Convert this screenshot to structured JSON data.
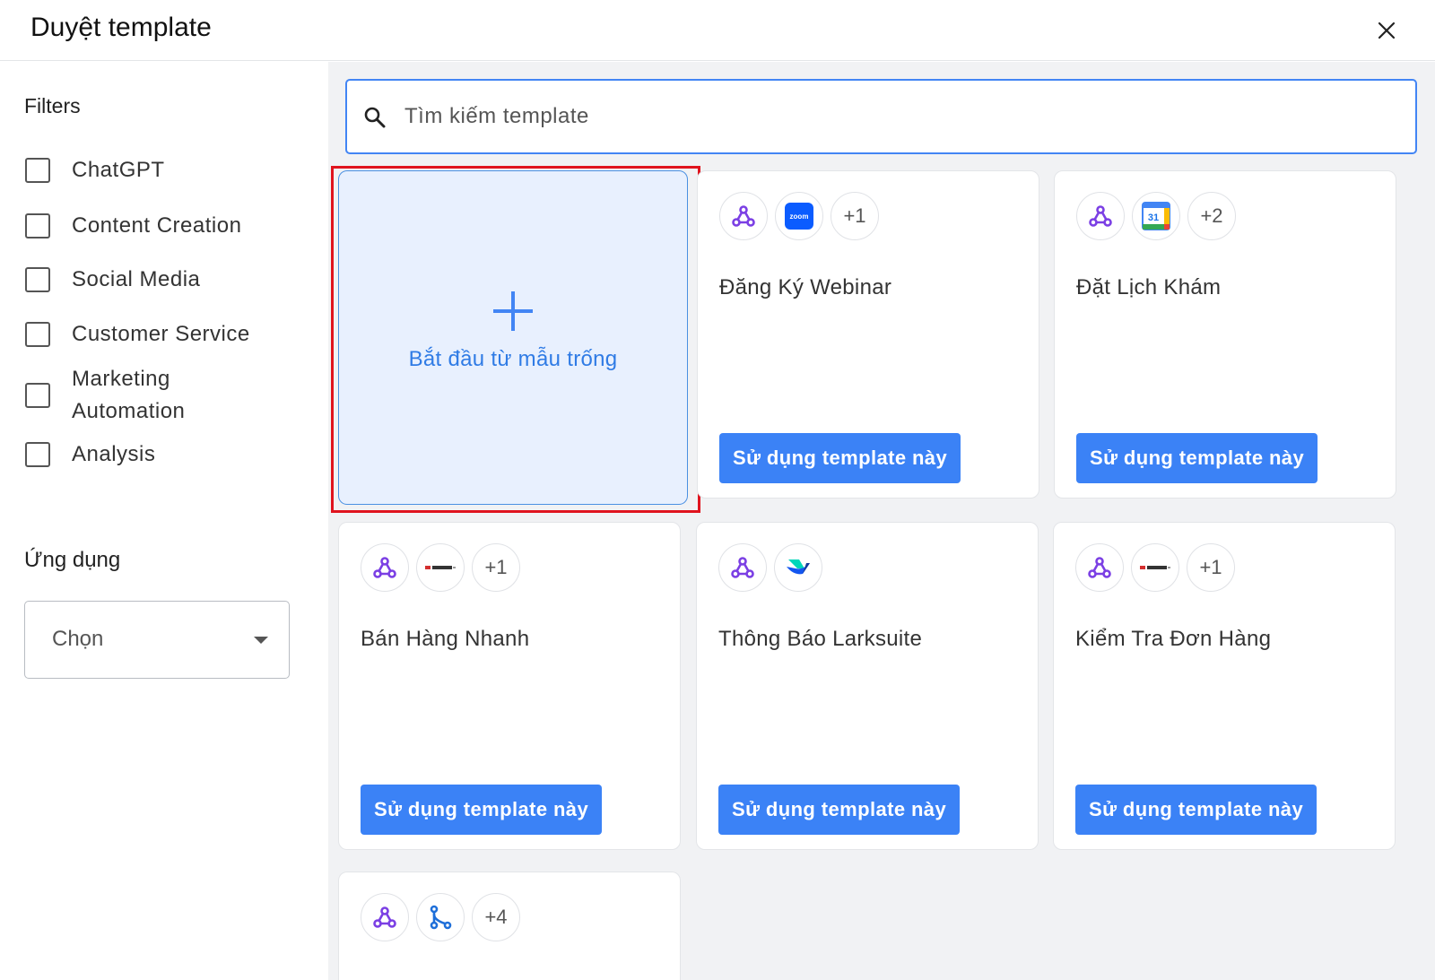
{
  "header": {
    "title": "Duyệt template"
  },
  "sidebar": {
    "filters_title": "Filters",
    "filters": [
      {
        "label": "ChatGPT",
        "checked": false
      },
      {
        "label": "Content Creation",
        "checked": false
      },
      {
        "label": "Social Media",
        "checked": false
      },
      {
        "label": "Customer Service",
        "checked": false
      },
      {
        "label": "Marketing Automation",
        "checked": false
      },
      {
        "label": "Analysis",
        "checked": false
      }
    ],
    "apps_title": "Ứng dụng",
    "apps_select": {
      "value": "Chọn"
    }
  },
  "search": {
    "placeholder": "Tìm kiếm template",
    "value": ""
  },
  "blank_card": {
    "label": "Bắt đầu từ mẫu trống"
  },
  "use_button_label": "Sử dụng template này",
  "templates": [
    {
      "name": "Đăng Ký Webinar",
      "icons": [
        "webhook-icon",
        "zoom-icon"
      ],
      "zoom_text": "zoom",
      "more": "+1"
    },
    {
      "name": "Đặt Lịch Khám",
      "icons": [
        "webhook-icon",
        "google-calendar-icon"
      ],
      "calendar_day": "31",
      "more": "+2"
    },
    {
      "name": "Bán Hàng Nhanh",
      "icons": [
        "webhook-icon",
        "nhanh-icon"
      ],
      "more": "+1"
    },
    {
      "name": "Thông Báo Larksuite",
      "icons": [
        "webhook-icon",
        "larksuite-icon"
      ],
      "more": ""
    },
    {
      "name": "Kiểm Tra Đơn Hàng",
      "icons": [
        "webhook-icon",
        "nhanh-icon"
      ],
      "more": "+1"
    },
    {
      "name": "",
      "icons": [
        "webhook-icon",
        "router-icon"
      ],
      "more": "+4"
    }
  ],
  "colors": {
    "accent": "#3b82f6",
    "blank_bg": "#e8f0fe",
    "highlight": "#e0141e",
    "webhook": "#7b3fe4"
  }
}
